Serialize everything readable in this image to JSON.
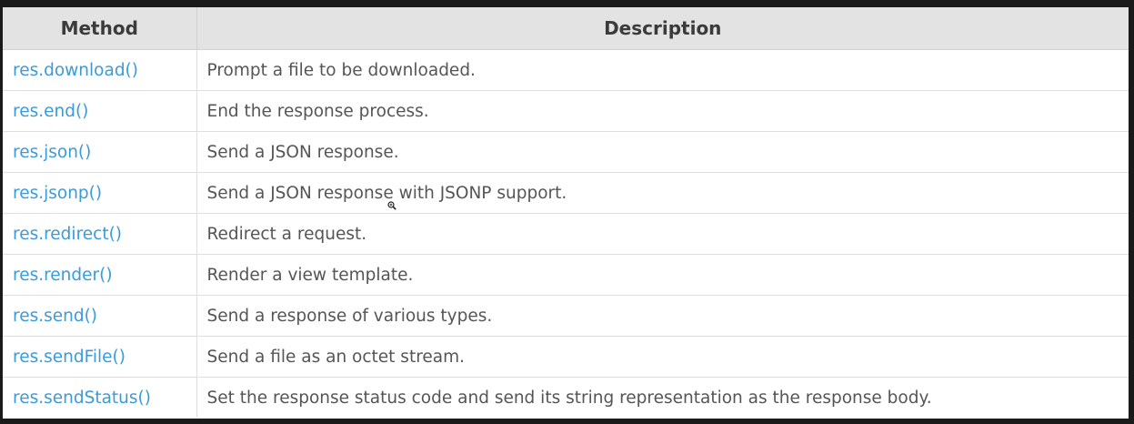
{
  "table": {
    "headers": [
      "Method",
      "Description"
    ],
    "rows": [
      {
        "method": "res.download()",
        "description": "Prompt a file to be downloaded."
      },
      {
        "method": "res.end()",
        "description": "End the response process."
      },
      {
        "method": "res.json()",
        "description": "Send a JSON response."
      },
      {
        "method": "res.jsonp()",
        "description": "Send a JSON response with JSONP support."
      },
      {
        "method": "res.redirect()",
        "description": "Redirect a request."
      },
      {
        "method": "res.render()",
        "description": "Render a view template."
      },
      {
        "method": "res.send()",
        "description": "Send a response of various types."
      },
      {
        "method": "res.sendFile()",
        "description": "Send a file as an octet stream."
      },
      {
        "method": "res.sendStatus()",
        "description": "Set the response status code and send its string representation as the response body."
      }
    ]
  },
  "colors": {
    "header_bg": "#e3e3e3",
    "link": "#3b9ad9",
    "text": "#555555",
    "frame_bg": "#1a1a1a"
  },
  "cursor": {
    "icon": "zoom-in-cursor-icon"
  }
}
